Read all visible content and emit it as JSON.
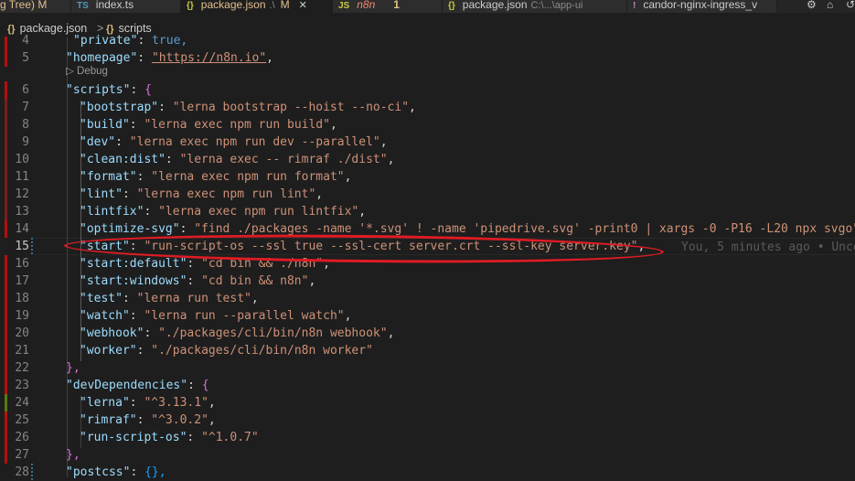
{
  "tabs": [
    {
      "icon": "",
      "label": "g Tree) M",
      "active": false
    },
    {
      "icon": "TS",
      "label": "index.ts",
      "active": false
    },
    {
      "icon": "{}",
      "label": "package.json",
      "desc": ".\\",
      "mark": "M",
      "active": true,
      "close": "✕"
    },
    {
      "icon": "JS",
      "label": "n8n",
      "num": "1",
      "active": false
    },
    {
      "icon": "{}",
      "label": "package.json",
      "desc": "C:\\...\\app-ui",
      "active": false
    },
    {
      "icon": "!",
      "label": "candor-nginx-ingress_v",
      "active": false
    }
  ],
  "breadcrumb": {
    "file": "package.json",
    "separator": ">",
    "symbol": "scripts",
    "file_icon": "{}",
    "symbol_icon": "{}"
  },
  "codelens": {
    "label": "▷ Debug"
  },
  "blame": "You, 5 minutes ago • Unco",
  "lines": [
    {
      "num": "4",
      "gutter": "mod"
    },
    {
      "num": "5",
      "gutter": "mod"
    },
    {
      "num": "6",
      "gutter": "mod"
    },
    {
      "num": "7",
      "gutter": "mod2"
    },
    {
      "num": "8",
      "gutter": "mod2"
    },
    {
      "num": "9",
      "gutter": "mod2"
    },
    {
      "num": "10",
      "gutter": "mod2"
    },
    {
      "num": "11",
      "gutter": "mod2"
    },
    {
      "num": "12",
      "gutter": "mod2"
    },
    {
      "num": "13",
      "gutter": "mod2"
    },
    {
      "num": "14",
      "gutter": "mod"
    },
    {
      "num": "15",
      "gutter": "none"
    },
    {
      "num": "16",
      "gutter": "mod"
    },
    {
      "num": "17",
      "gutter": "mod"
    },
    {
      "num": "18",
      "gutter": "mod"
    },
    {
      "num": "19",
      "gutter": "mod"
    },
    {
      "num": "20",
      "gutter": "mod"
    },
    {
      "num": "21",
      "gutter": "mod"
    },
    {
      "num": "22",
      "gutter": "mod"
    },
    {
      "num": "23",
      "gutter": "mod"
    },
    {
      "num": "24",
      "gutter": "add"
    },
    {
      "num": "25",
      "gutter": "mod"
    },
    {
      "num": "26",
      "gutter": "mod"
    },
    {
      "num": "27",
      "gutter": "mod"
    },
    {
      "num": "28",
      "gutter": "none"
    }
  ],
  "code": {
    "l4": {
      "key": "\"private\"",
      "val": "true,"
    },
    "l5": {
      "key": "\"homepage\"",
      "val": "\"https://n8n.io\""
    },
    "l6": {
      "key": "\"scripts\"",
      "brace": "{"
    },
    "l7": {
      "key": "\"bootstrap\"",
      "val": "\"lerna bootstrap --hoist --no-ci\""
    },
    "l8": {
      "key": "\"build\"",
      "val": "\"lerna exec npm run build\""
    },
    "l9": {
      "key": "\"dev\"",
      "val": "\"lerna exec npm run dev --parallel\""
    },
    "l10": {
      "key": "\"clean:dist\"",
      "val": "\"lerna exec -- rimraf ./dist\""
    },
    "l11": {
      "key": "\"format\"",
      "val": "\"lerna exec npm run format\""
    },
    "l12": {
      "key": "\"lint\"",
      "val": "\"lerna exec npm run lint\""
    },
    "l13": {
      "key": "\"lintfix\"",
      "val": "\"lerna exec npm run lintfix\""
    },
    "l14": {
      "key": "\"optimize-svg\"",
      "val": "\"find ./packages -name '*.svg' ! -name 'pipedrive.svg' -print0 | xargs -0 -P16 -L20 npx svgo\""
    },
    "l15": {
      "key": "\"start\"",
      "val": "\"run-script-os --ssl true --ssl-cert server.crt --ssl-key server.key\""
    },
    "l16": {
      "key": "\"start:default\"",
      "val": "\"cd bin && ./n8n\""
    },
    "l17": {
      "key": "\"start:windows\"",
      "val": "\"cd bin && n8n\""
    },
    "l18": {
      "key": "\"test\"",
      "val": "\"lerna run test\""
    },
    "l19": {
      "key": "\"watch\"",
      "val": "\"lerna run --parallel watch\""
    },
    "l20": {
      "key": "\"webhook\"",
      "val": "\"./packages/cli/bin/n8n webhook\""
    },
    "l21": {
      "key": "\"worker\"",
      "val": "\"./packages/cli/bin/n8n worker\""
    },
    "l22": {
      "brace": "},"
    },
    "l23": {
      "key": "\"devDependencies\"",
      "brace": "{"
    },
    "l24": {
      "key": "\"lerna\"",
      "val": "\"^3.13.1\""
    },
    "l25": {
      "key": "\"rimraf\"",
      "val": "\"^3.0.2\""
    },
    "l26": {
      "key": "\"run-script-os\"",
      "val": "\"^1.0.7\""
    },
    "l27": {
      "brace": "},"
    },
    "l28": {
      "key": "\"postcss\"",
      "val": "{},"
    }
  },
  "colors": {
    "annotation": "#e01b24",
    "key": "#9cdcfe",
    "string": "#ce9178",
    "brace": "#da70d6"
  }
}
